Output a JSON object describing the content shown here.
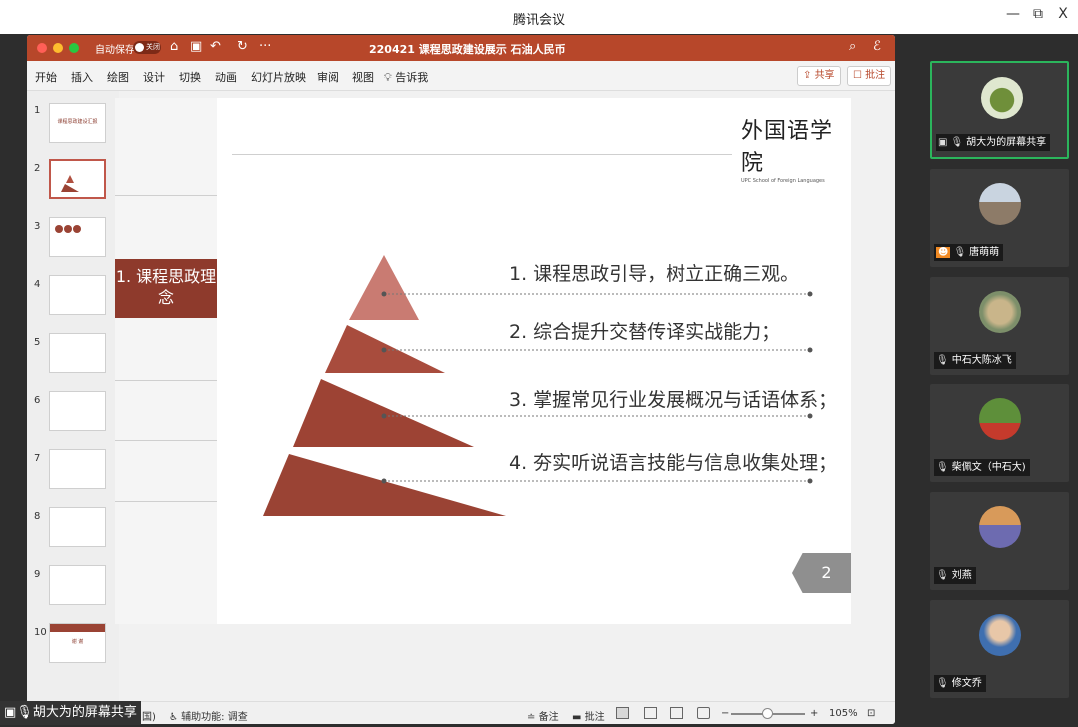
{
  "window": {
    "title": "腾讯会议",
    "minimize": "—",
    "restore": "⧉",
    "close": "X"
  },
  "ppt": {
    "autosave_label": "自动保存",
    "autosave_state": "关闭",
    "doc_title": "220421 课程思政建设展示 石油人民币",
    "tabs": [
      "开始",
      "插入",
      "绘图",
      "设计",
      "切换",
      "动画",
      "幻灯片放映",
      "审阅",
      "视图",
      "告诉我"
    ],
    "share_label": "共享",
    "comment_label": "批注",
    "status": {
      "language": "国)",
      "accessibility": "辅助功能: 调查",
      "notes": "备注",
      "comments": "批注",
      "zoom": "105%"
    }
  },
  "thumbnails": [
    {
      "num": "1",
      "caption": "课程思政建设汇报"
    },
    {
      "num": "2",
      "caption": ""
    },
    {
      "num": "3",
      "caption": ""
    },
    {
      "num": "4",
      "caption": ""
    },
    {
      "num": "5",
      "caption": ""
    },
    {
      "num": "6",
      "caption": ""
    },
    {
      "num": "7",
      "caption": ""
    },
    {
      "num": "8",
      "caption": ""
    },
    {
      "num": "9",
      "caption": ""
    },
    {
      "num": "10",
      "caption": "谢 谢"
    }
  ],
  "slide": {
    "section": "1. 课程思政理念",
    "logo_main": "外国语学院",
    "logo_sub": "UPC School of Foreign Languages",
    "bullets": [
      "1. 课程思政引导，树立正确三观。",
      "2. 综合提升交替传译实战能力；",
      "3. 掌握常见行业发展概况与话语体系；",
      "4. 夯实听说语言技能与信息收集处理；"
    ],
    "page_number": "2",
    "colors": {
      "tier1": "#c97b72",
      "tier2": "#a84c3d",
      "tier3": "#9d4334",
      "tier4": "#9a4334"
    }
  },
  "participants": [
    {
      "name": "胡大为的屏幕共享",
      "active": true
    },
    {
      "name": "唐萌萌",
      "active": false
    },
    {
      "name": "中石大陈冰飞",
      "active": false
    },
    {
      "name": "柴佩文（中石大)",
      "active": false
    },
    {
      "name": "刘燕",
      "active": false
    },
    {
      "name": "修文乔",
      "active": false
    }
  ],
  "share_badge": "胡大为的屏幕共享"
}
